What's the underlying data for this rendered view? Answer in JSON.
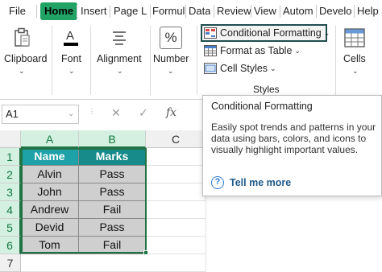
{
  "tabs": [
    "File",
    "Home",
    "Insert",
    "Page L",
    "Formul",
    "Data",
    "Review",
    "View",
    "Autom",
    "Develo",
    "Help"
  ],
  "ribbon": {
    "clipboard": "Clipboard",
    "font": "Font",
    "alignment": "Alignment",
    "number": "Number",
    "conditional_formatting": "Conditional Formatting",
    "format_as_table": "Format as Table",
    "cell_styles": "Cell Styles",
    "styles_group": "Styles",
    "cells": "Cells",
    "number_symbol": "%"
  },
  "formula_bar": {
    "name_box": "A1",
    "cancel": "✕",
    "enter": "✓",
    "fx": "fx"
  },
  "grid": {
    "columns": [
      "A",
      "B",
      "C"
    ],
    "rows": [
      "1",
      "2",
      "3",
      "4",
      "5",
      "6",
      "7"
    ],
    "header": [
      "Name",
      "Marks"
    ],
    "data": [
      [
        "Alvin",
        "Pass"
      ],
      [
        "John",
        "Pass"
      ],
      [
        "Andrew",
        "Fail"
      ],
      [
        "Devid",
        "Pass"
      ],
      [
        "Tom",
        "Fail"
      ]
    ]
  },
  "tooltip": {
    "title": "Conditional Formatting",
    "body": "Easily spot trends and patterns in your data using bars, colors, and icons to visually highlight important values.",
    "link": "Tell me more",
    "help_symbol": "?"
  },
  "colors": {
    "accent_green": "#21a366",
    "header_name": "#1ea2a8",
    "header_marks": "#178a8a",
    "data_fill": "#cfcfcf"
  }
}
